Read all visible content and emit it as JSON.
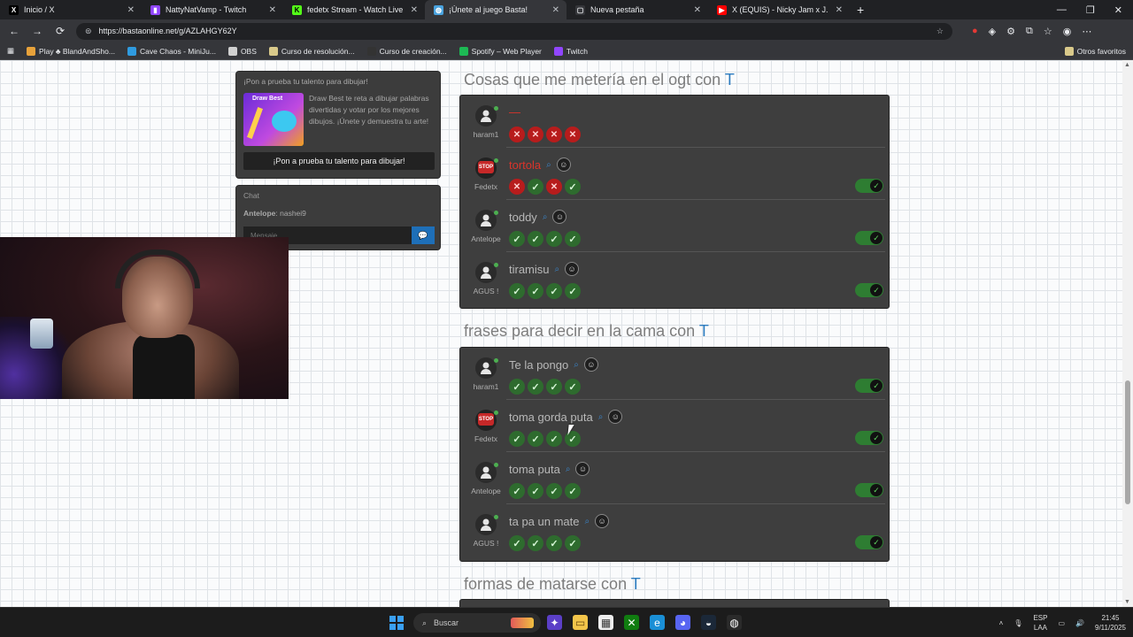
{
  "browser": {
    "tabs": [
      {
        "title": "Inicio / X",
        "favicon": "x-logo-icon",
        "active": false
      },
      {
        "title": "NattyNatVamp - Twitch",
        "favicon": "twitch-icon",
        "active": false
      },
      {
        "title": "fedetx Stream - Watch Live on Kick",
        "favicon": "kick-icon",
        "active": false
      },
      {
        "title": "¡Únete al juego Basta!",
        "favicon": "globe-icon",
        "active": true
      },
      {
        "title": "Nueva pestaña",
        "favicon": "newtab-icon",
        "active": false
      },
      {
        "title": "X (EQUIS) - Nicky Jam x J. Balvin",
        "favicon": "youtube-icon",
        "active": false
      }
    ],
    "new_tab": "+",
    "url": "https://bastaonline.net/g/AZLAHGY62Y",
    "bookmarks": [
      "Play ♣ BlandAndSho...",
      "Cave Chaos - MiniJu...",
      "OBS",
      "Curso de resolución...",
      "Curso de creación...",
      "Spotify – Web Player",
      "Twitch"
    ],
    "other_bookmarks": "Otros favoritos"
  },
  "promo": {
    "title": "¡Pon a prueba tu talento para dibujar!",
    "image_label": "Draw Best",
    "text": "Draw Best te reta a dibujar palabras divertidas y votar por los mejores dibujos. ¡Únete y demuestra tu arte!",
    "button": "¡Pon a prueba tu talento para dibujar!"
  },
  "chat": {
    "title": "Chat",
    "messages": [
      {
        "user": "Antelope",
        "text": "nashei9"
      }
    ],
    "input_placeholder": "Mensaje...",
    "send_icon": "chat-bubble-icon"
  },
  "sections": [
    {
      "title": "Cosas que me metería en el ogt con",
      "letter": "T",
      "answers": [
        {
          "user": "haram1",
          "word": "—",
          "marks": [
            "no",
            "no",
            "no",
            "no"
          ],
          "accepted": false,
          "avatar": "person",
          "word_style": "bad"
        },
        {
          "user": "Fedetx",
          "word": "tortola",
          "marks": [
            "no",
            "ok",
            "no",
            "ok"
          ],
          "accepted": true,
          "avatar": "stop",
          "word_style": "bad"
        },
        {
          "user": "Antelope",
          "word": "toddy",
          "marks": [
            "ok",
            "ok",
            "ok",
            "ok"
          ],
          "accepted": true,
          "avatar": "person",
          "word_style": "normal"
        },
        {
          "user": "AGUS !",
          "word": "tiramisu",
          "marks": [
            "ok",
            "ok",
            "ok",
            "ok"
          ],
          "accepted": true,
          "avatar": "person",
          "word_style": "normal"
        }
      ]
    },
    {
      "title": "frases para decir en la cama con",
      "letter": "T",
      "answers": [
        {
          "user": "haram1",
          "word": "Te la pongo",
          "marks": [
            "ok",
            "ok",
            "ok",
            "ok"
          ],
          "accepted": true,
          "avatar": "person",
          "word_style": "normal"
        },
        {
          "user": "Fedetx",
          "word": "toma gorda puta",
          "marks": [
            "ok",
            "ok",
            "ok",
            "ok"
          ],
          "accepted": true,
          "avatar": "stop",
          "word_style": "normal"
        },
        {
          "user": "Antelope",
          "word": "toma puta",
          "marks": [
            "ok",
            "ok",
            "ok",
            "ok"
          ],
          "accepted": true,
          "avatar": "person",
          "word_style": "normal"
        },
        {
          "user": "AGUS !",
          "word": "ta pa un mate",
          "marks": [
            "ok",
            "ok",
            "ok",
            "ok"
          ],
          "accepted": true,
          "avatar": "person",
          "word_style": "normal"
        }
      ]
    },
    {
      "title": "formas de matarse con",
      "letter": "T",
      "answers": []
    }
  ],
  "stop_sign_label": "STOP",
  "taskbar": {
    "search_placeholder": "Buscar",
    "lang_top": "ESP",
    "lang_bottom": "LAA",
    "time": "21:45",
    "date": "9/11/2025"
  },
  "colors": {
    "accent_letter": "#2b7bbf",
    "accepted": "#2e7d32",
    "rejected": "#b71c1c",
    "card_bg": "#3e3e3e"
  }
}
